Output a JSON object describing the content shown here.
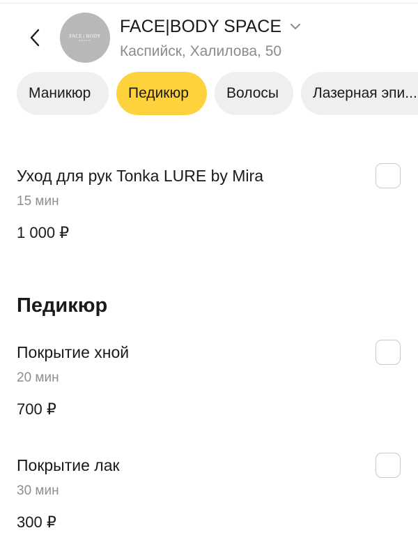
{
  "header": {
    "back_icon": "chevron-left-icon",
    "logo": {
      "main": "FACE | BODY",
      "sub": "SPACE"
    },
    "salon_name": "FACE|BODY SPACE",
    "dropdown_icon": "chevron-down-icon",
    "address": "Каспийск, Халилова, 50"
  },
  "categories": [
    {
      "label": "Маникюр",
      "active": false
    },
    {
      "label": "Педикюр",
      "active": true
    },
    {
      "label": "Волосы",
      "active": false
    },
    {
      "label": "Лазерная эпи...",
      "active": false
    }
  ],
  "colors": {
    "accent": "#FED23C",
    "chip_bg": "#EFEFEF",
    "muted_text": "#8B8B8B",
    "logo_bg": "#B8B8B8"
  },
  "manicure_services": [
    {
      "title": "Уход для рук Tonka LURE by Mira",
      "duration": "15 мин",
      "price": "1 000 ₽",
      "selected": false
    }
  ],
  "pedicure_section": {
    "title": "Педикюр",
    "services": [
      {
        "title": "Покрытие хной",
        "duration": "20 мин",
        "price": "700 ₽",
        "selected": false
      },
      {
        "title": "Покрытие лак",
        "duration": "30 мин",
        "price": "300 ₽",
        "selected": false
      }
    ]
  }
}
